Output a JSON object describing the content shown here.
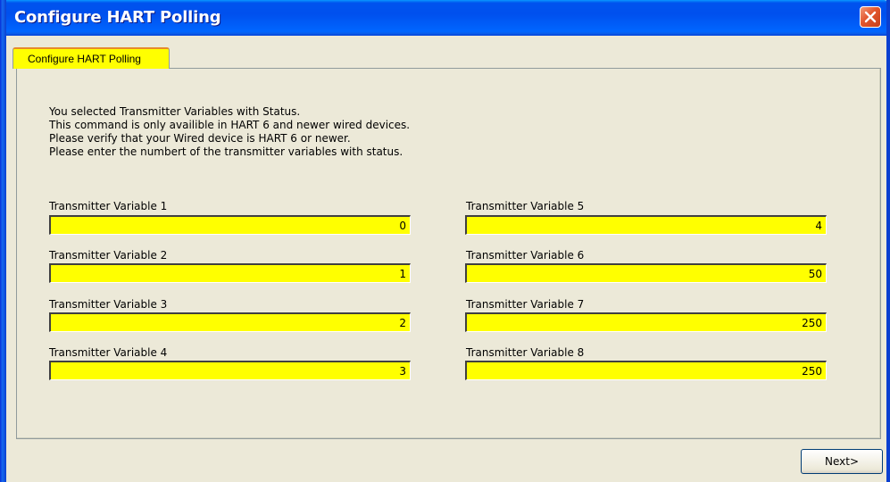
{
  "window": {
    "title": "Configure HART Polling"
  },
  "tab": {
    "label": "Configure HART Polling"
  },
  "message": [
    "You selected Transmitter Variables with Status.",
    "This command is only availible in HART 6 and newer wired devices.",
    "Please verify that your Wired device is HART 6 or newer.",
    "Please enter the numbert of the transmitter variables with status."
  ],
  "variables": [
    {
      "label": "Transmitter Variable 1",
      "value": "0"
    },
    {
      "label": "Transmitter Variable 2",
      "value": "1"
    },
    {
      "label": "Transmitter Variable 3",
      "value": "2"
    },
    {
      "label": "Transmitter Variable 4",
      "value": "3"
    },
    {
      "label": "Transmitter Variable 5",
      "value": "4"
    },
    {
      "label": "Transmitter Variable 6",
      "value": "50"
    },
    {
      "label": "Transmitter Variable 7",
      "value": "250"
    },
    {
      "label": "Transmitter Variable 8",
      "value": "250"
    }
  ],
  "buttons": {
    "next_label": "Next>"
  },
  "colors": {
    "field_background": "#ffff00",
    "tab_background": "#ffff00",
    "titlebar": "#0050ee",
    "close_button": "#e2552c"
  },
  "icons": {
    "close": "close-icon"
  }
}
